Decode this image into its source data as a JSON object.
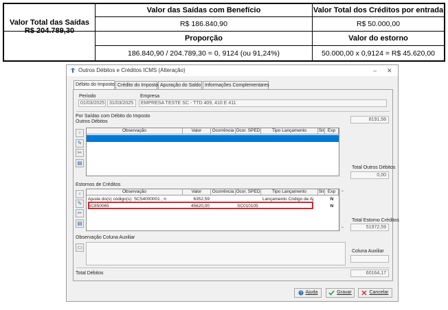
{
  "summary": {
    "left_label": "Valor Total das Saídas",
    "left_value": "R$ 204.789,30",
    "h1": "Valor das Saídas com Benefício",
    "h2": "Valor Total dos Créditos por entrada",
    "v1": "R$ 186.840,90",
    "v2": "R$ 50.000,00",
    "h3": "Proporção",
    "h4": "Valor do estorno",
    "v3": "186.840,90 / 204.789,30 = 0, 9124 (ou 91,24%)",
    "v4": "50.000,00 x 0,9124 = R$ 45.620,00"
  },
  "dialog": {
    "title": "Outros Débitos e Créditos ICMS (Alteração)",
    "minimize": "‒",
    "close": "✕",
    "tabs": [
      "Débito do Imposto",
      "Crédito do Imposto",
      "Apuração do Saldo",
      "Informações Complementares"
    ],
    "periodo_label": "Período",
    "periodo_inicio": "01/03/2025",
    "periodo_fim": "31/03/2025",
    "empresa_label": "Empresa",
    "empresa_value": "EMPRESA TESTE SC - TTD 409, 410 E 411",
    "saidas_label": "Por Saídas com Débito do Imposto",
    "saidas_value": "8191,58",
    "outros_debitos_label": "Outros Débitos",
    "columns": [
      "Observação",
      "Valor",
      "Ocorrência",
      "Ocor. SPED",
      "Tipo Lançamento",
      "Sit",
      "Exp"
    ],
    "total_outros_debitos_label": "Total Outros Débitos",
    "total_outros_debitos_value": "0,00",
    "estornos_label": "Estornos de Créditos",
    "estornos_rows": [
      {
        "obs": "Ajuste do(s) código(s): SC54000001 , n",
        "valor": "6352,59",
        "ocorrencia": "",
        "ocor_sped": "",
        "tipo": "Lançamento Código de Aj",
        "sit": "",
        "exp": "N"
      },
      {
        "obs": "SC850065",
        "valor": "45620,00",
        "ocorrencia": "",
        "ocor_sped": "SC010105",
        "tipo": "",
        "sit": "",
        "exp": "N"
      }
    ],
    "total_estorno_label": "Total Estorno Créditos",
    "total_estorno_value": "51972,59",
    "obs_aux_label": "Observação Coluna Auxiliar",
    "coluna_aux_label": "Coluna Auxiliar",
    "coluna_aux_value": "",
    "total_debitos_label": "Total Débitos",
    "total_debitos_value": "60164,17",
    "btn_ajuda": "Ajuda",
    "btn_gravar": "Gravar",
    "btn_cancelar": "Cancelar"
  }
}
